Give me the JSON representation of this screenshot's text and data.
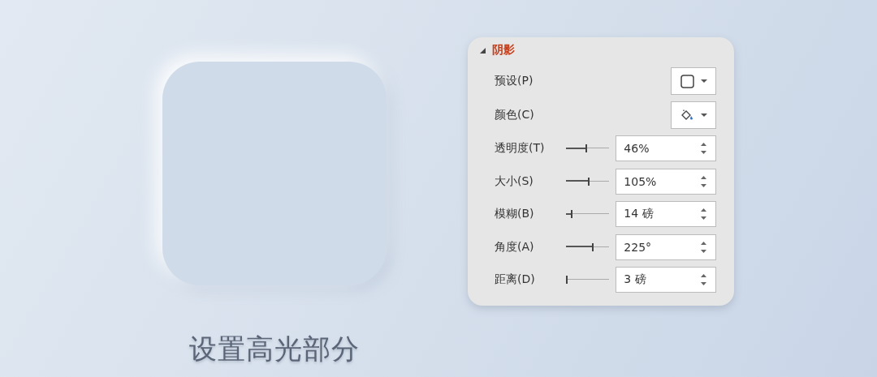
{
  "preview": {
    "caption": "设置高光部分"
  },
  "panel": {
    "section": {
      "title": "阴影",
      "expanded": true
    },
    "rows": [
      {
        "kind": "preset",
        "label": "预设(P)"
      },
      {
        "kind": "color",
        "label": "颜色(C)"
      },
      {
        "kind": "slider",
        "label": "透明度(T)",
        "level": 0.46,
        "value": "46%"
      },
      {
        "kind": "slider",
        "label": "大小(S)",
        "level": 0.52,
        "value": "105%"
      },
      {
        "kind": "slider",
        "label": "模糊(B)",
        "level": 0.12,
        "value": "14 磅"
      },
      {
        "kind": "slider",
        "label": "角度(A)",
        "level": 0.62,
        "value": "225°"
      },
      {
        "kind": "slider",
        "label": "距离(D)",
        "level": 0.02,
        "value": "3 磅"
      }
    ]
  }
}
